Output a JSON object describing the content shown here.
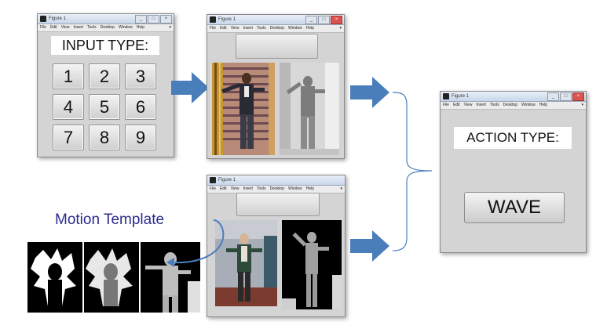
{
  "menu_items": [
    "File",
    "Edit",
    "View",
    "Insert",
    "Tools",
    "Desktop",
    "Window",
    "Help"
  ],
  "windows": {
    "input": {
      "title": "Figure 1",
      "label": "INPUT TYPE:",
      "keys": [
        "1",
        "2",
        "3",
        "4",
        "5",
        "6",
        "7",
        "8",
        "9"
      ]
    },
    "top_preview": {
      "title": "Figure 1"
    },
    "bottom_preview": {
      "title": "Figure 1"
    },
    "action": {
      "title": "Figure 1",
      "label": "ACTION TYPE:",
      "result_button": "WAVE"
    }
  },
  "motion_template": {
    "label": "Motion Template"
  },
  "colors": {
    "arrow_blue": "#4a7ebb",
    "window_gray": "#d4d4d4",
    "label_text": "#2b2b8f"
  },
  "icons": {
    "window_icon": "matlab-figure-icon",
    "minimize": "minimize-icon",
    "maximize": "maximize-icon",
    "close": "close-icon"
  }
}
